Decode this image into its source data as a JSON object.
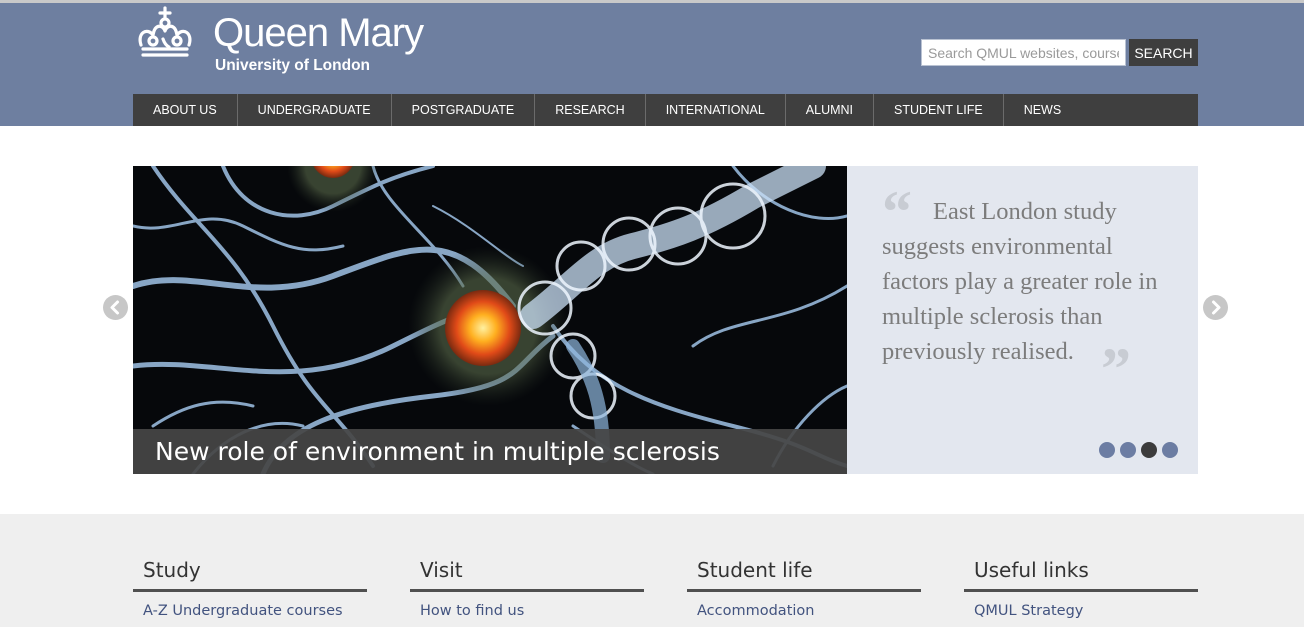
{
  "brand": {
    "name": "Queen Mary",
    "subtitle": "University of London"
  },
  "search": {
    "placeholder": "Search QMUL websites, courses",
    "button_label": "SEARCH"
  },
  "nav": [
    {
      "label": "ABOUT US"
    },
    {
      "label": "UNDERGRADUATE"
    },
    {
      "label": "POSTGRADUATE"
    },
    {
      "label": "RESEARCH"
    },
    {
      "label": "INTERNATIONAL"
    },
    {
      "label": "ALUMNI"
    },
    {
      "label": "STUDENT LIFE"
    },
    {
      "label": "NEWS"
    }
  ],
  "hero": {
    "caption": "New role of environment in multiple sclerosis",
    "quote": "East London study suggests environmental factors play a greater role in multiple sclerosis than previously realised.",
    "slide_count": 4,
    "active_slide": 3
  },
  "footer": {
    "columns": [
      {
        "title": "Study",
        "links": [
          "A-Z Undergraduate courses"
        ]
      },
      {
        "title": "Visit",
        "links": [
          "How to find us"
        ]
      },
      {
        "title": "Student life",
        "links": [
          "Accommodation"
        ]
      },
      {
        "title": "Useful links",
        "links": [
          "QMUL Strategy"
        ]
      }
    ]
  },
  "colors": {
    "header_bg": "#6e7fa0",
    "nav_bg": "#3f3f3f",
    "quote_panel_bg": "#e3e7ef",
    "footer_bg": "#efefef",
    "link": "#42537f"
  },
  "icons": [
    "crown-logo-icon",
    "quote-open-icon",
    "quote-close-icon",
    "chevron-left-icon",
    "chevron-right-icon"
  ]
}
